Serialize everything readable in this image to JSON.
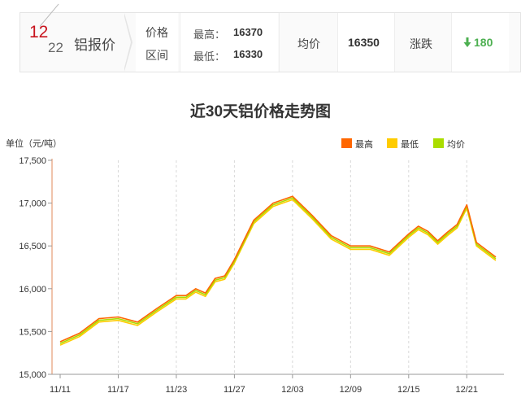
{
  "quote": {
    "month": "12",
    "day": "22",
    "product": "铝报价",
    "range_label_1": "价格",
    "range_label_2": "区间",
    "high_label": "最高：",
    "high_value": "16370",
    "low_label": "最低：",
    "low_value": "16330",
    "avg_label": "均价",
    "avg_value": "16350",
    "change_label": "涨跌",
    "change_value": "180",
    "change_direction": "down",
    "change_color": "#4caf50",
    "month_color": "#c8141e"
  },
  "chart_data": {
    "type": "line",
    "title": "近30天铝价格走势图",
    "unit_label": "单位（元/吨）",
    "ylim": [
      15000,
      17500
    ],
    "y_ticks": [
      "15,000",
      "15,500",
      "16,000",
      "16,500",
      "17,000",
      "17,500"
    ],
    "y_tick_values": [
      15000,
      15500,
      16000,
      16500,
      17000,
      17500
    ],
    "x_tick_labels": [
      "11/11",
      "11/17",
      "11/23",
      "11/27",
      "12/03",
      "12/09",
      "12/15",
      "12/21"
    ],
    "x_tick_indices": [
      0,
      6,
      12,
      18,
      24,
      30,
      36,
      42
    ],
    "grid": "vertical dashed",
    "legend_position": "top-right",
    "categories_count": 45,
    "series": [
      {
        "name": "最高",
        "color": "#ff6600",
        "values": [
          15380,
          15480,
          15650,
          15670,
          15610,
          15770,
          15920,
          15920,
          16000,
          15950,
          16120,
          16150,
          16340,
          16800,
          17000,
          17080,
          16860,
          16620,
          16500,
          16500,
          16430,
          16640,
          16730,
          16670,
          16560,
          16660,
          16750,
          16980,
          16540,
          16370
        ]
      },
      {
        "name": "最低",
        "color": "#ffcc00",
        "values": [
          15340,
          15440,
          15610,
          15630,
          15570,
          15730,
          15880,
          15880,
          15960,
          15910,
          16080,
          16110,
          16300,
          16760,
          16960,
          17040,
          16820,
          16580,
          16460,
          16460,
          16390,
          16600,
          16690,
          16630,
          16520,
          16620,
          16710,
          16940,
          16500,
          16330
        ]
      },
      {
        "name": "均价",
        "color": "#aadd00",
        "values": [
          15360,
          15460,
          15630,
          15650,
          15590,
          15750,
          15900,
          15900,
          15980,
          15930,
          16100,
          16130,
          16320,
          16780,
          16980,
          17060,
          16840,
          16600,
          16480,
          16480,
          16410,
          16620,
          16710,
          16650,
          16540,
          16640,
          16730,
          16960,
          16520,
          16350
        ]
      }
    ],
    "x_positions_index": [
      0,
      2,
      4,
      6,
      8,
      10,
      12,
      13,
      14,
      15,
      16,
      17,
      18,
      20,
      22,
      24,
      26,
      28,
      30,
      32,
      34,
      36,
      37,
      38,
      39,
      40,
      41,
      42,
      43,
      45
    ]
  }
}
